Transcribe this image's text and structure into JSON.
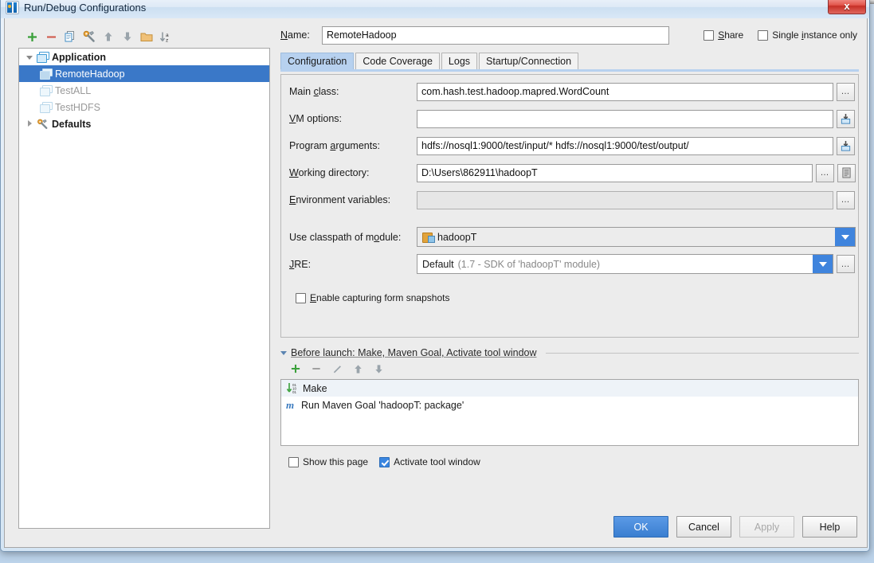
{
  "window": {
    "title": "Run/Debug Configurations",
    "app_icon": "intellij-idea-icon",
    "close_label": "x"
  },
  "tree_toolbar": {
    "buttons": [
      {
        "name": "add-configuration-button",
        "icon": "plus-icon"
      },
      {
        "name": "remove-configuration-button",
        "icon": "minus-icon"
      },
      {
        "name": "copy-configuration-button",
        "icon": "copy-icon"
      },
      {
        "name": "edit-defaults-button",
        "icon": "wrench-icon"
      },
      {
        "name": "move-up-button",
        "icon": "arrow-up-icon"
      },
      {
        "name": "move-down-button",
        "icon": "arrow-down-icon"
      },
      {
        "name": "create-folder-button",
        "icon": "folder-icon"
      },
      {
        "name": "sort-configurations-button",
        "icon": "sort-az-icon"
      }
    ]
  },
  "tree": {
    "nodes": [
      {
        "label": "Application",
        "level": 0,
        "expanded": true,
        "bold": true,
        "icon": "application-icon",
        "state": "normal"
      },
      {
        "label": "RemoteHadoop",
        "level": 1,
        "icon": "application-icon",
        "state": "selected"
      },
      {
        "label": "TestALL",
        "level": 1,
        "icon": "application-icon",
        "state": "dim"
      },
      {
        "label": "TestHDFS",
        "level": 1,
        "icon": "application-icon",
        "state": "dim"
      },
      {
        "label": "Defaults",
        "level": 0,
        "expanded": false,
        "bold": true,
        "icon": "wrench-icon",
        "state": "normal"
      }
    ]
  },
  "header": {
    "name_label": "Name:",
    "name_value": "RemoteHadoop",
    "share_label": "Share",
    "share_checked": false,
    "single_instance_label": "Single instance only",
    "single_instance_checked": false
  },
  "tabs": [
    {
      "label": "Configuration",
      "active": true
    },
    {
      "label": "Code Coverage",
      "active": false
    },
    {
      "label": "Logs",
      "active": false
    },
    {
      "label": "Startup/Connection",
      "active": false
    }
  ],
  "configuration": {
    "main_class": {
      "label": "Main class:",
      "value": "com.hash.test.hadoop.mapred.WordCount",
      "button": "browse-ellipsis"
    },
    "vm_options": {
      "label": "VM options:",
      "value": "",
      "button": "expand-editor"
    },
    "program_arguments": {
      "label": "Program arguments:",
      "value": "hdfs://nosql1:9000/test/input/* hdfs://nosql1:9000/test/output/",
      "button": "expand-editor"
    },
    "working_directory": {
      "label": "Working directory:",
      "value": "D:\\Users\\862911\\hadoopT",
      "button": "browse-ellipsis",
      "button2": "insert-macro"
    },
    "environment_variables": {
      "label": "Environment variables:",
      "value": "",
      "button": "browse-ellipsis"
    },
    "classpath_module": {
      "label": "Use classpath of module:",
      "value": "hadoopT",
      "icon": "module-icon"
    },
    "jre": {
      "label": "JRE:",
      "value": "Default",
      "hint": "(1.7 - SDK of 'hadoopT' module)",
      "button": "browse-ellipsis"
    },
    "form_snapshots": {
      "label": "Enable capturing form snapshots",
      "checked": false
    }
  },
  "before_launch": {
    "title": "Before launch: Make, Maven Goal, Activate tool window",
    "toolbar": [
      {
        "name": "add-task-button",
        "icon": "plus-icon"
      },
      {
        "name": "remove-task-button",
        "icon": "minus-icon"
      },
      {
        "name": "edit-task-button",
        "icon": "pencil-icon"
      },
      {
        "name": "task-move-up-button",
        "icon": "arrow-up-icon"
      },
      {
        "name": "task-move-down-button",
        "icon": "arrow-down-icon"
      }
    ],
    "tasks": [
      {
        "label": "Make",
        "icon": "make-icon"
      },
      {
        "label": "Run Maven Goal 'hadoopT: package'",
        "icon": "maven-icon"
      }
    ]
  },
  "options": {
    "show_this_page": {
      "label": "Show this page",
      "checked": false
    },
    "activate_tool_window": {
      "label": "Activate tool window",
      "checked": true
    }
  },
  "buttons": {
    "ok": "OK",
    "cancel": "Cancel",
    "apply": "Apply",
    "help": "Help"
  },
  "colors": {
    "accent": "#3a78c8",
    "primary_button": "#3a7ed0",
    "tab_active": "#b7d1ef",
    "close_button": "#c62f26"
  }
}
